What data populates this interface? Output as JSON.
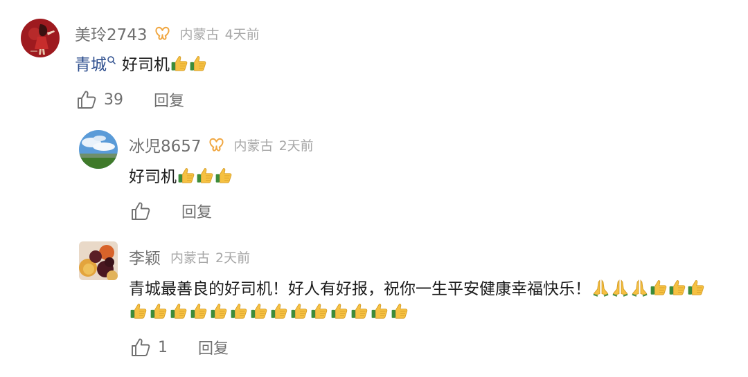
{
  "comments": [
    {
      "username": "美玲2743",
      "badge_icon": "butterfly-badge-icon",
      "location": "内蒙古",
      "time": "4天前",
      "mention": "青城",
      "text": "好司机",
      "emoji": [
        "thumbs-up",
        "thumbs-up"
      ],
      "like_count": "39",
      "reply_label": "回复"
    },
    {
      "username": "冰児8657",
      "badge_icon": "butterfly-badge-icon",
      "location": "内蒙古",
      "time": "2天前",
      "text": "好司机",
      "emoji": [
        "thumbs-up",
        "thumbs-up",
        "thumbs-up"
      ],
      "like_count": "",
      "reply_label": "回复"
    },
    {
      "username": "李颖",
      "location": "内蒙古",
      "time": "2天前",
      "text": "青城最善良的好司机！好人有好报，祝你一生平安健康幸福快乐！",
      "emoji_line1": [
        "folded-hands",
        "folded-hands",
        "folded-hands",
        "thumbs-up",
        "thumbs-up",
        "thumbs-up"
      ],
      "emoji_line2_count": 14,
      "emoji_line2": "thumbs-up",
      "like_count": "1",
      "reply_label": "回复"
    }
  ],
  "colors": {
    "username": "#6f6f6f",
    "meta": "#a7a7a7",
    "link": "#2d4e8e",
    "badge": "#f0a640"
  }
}
